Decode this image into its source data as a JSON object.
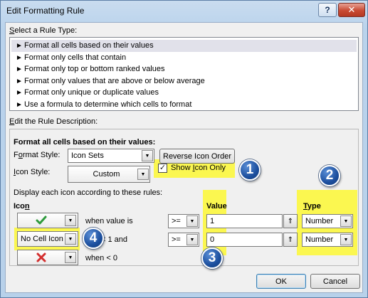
{
  "window": {
    "title": "Edit Formatting Rule",
    "help_glyph": "?",
    "close_glyph": "✕"
  },
  "rule_type": {
    "label_accel": "S",
    "label_rest": "elect a Rule Type:",
    "items": [
      {
        "label": "Format all cells based on their values",
        "selected": true
      },
      {
        "label": "Format only cells that contain",
        "selected": false
      },
      {
        "label": "Format only top or bottom ranked values",
        "selected": false
      },
      {
        "label": "Format only values that are above or below average",
        "selected": false
      },
      {
        "label": "Format only unique or duplicate values",
        "selected": false
      },
      {
        "label": "Use a formula to determine which cells to format",
        "selected": false
      }
    ]
  },
  "description": {
    "label_accel": "E",
    "label_rest": "dit the Rule Description:",
    "heading": "Format all cells based on their values:",
    "format_style_label_pre": "F",
    "format_style_label_accel": "o",
    "format_style_label_post": "rmat Style:",
    "format_style_value": "Icon Sets",
    "reverse_icon_order_label": "Reverse Icon Order",
    "icon_style_label_pre": "",
    "icon_style_label_accel": "I",
    "icon_style_label_post": "con Style:",
    "icon_style_value": "Custom",
    "show_icon_only_pre": "Show ",
    "show_icon_only_accel": "I",
    "show_icon_only_post": "con Only",
    "show_icon_only_checked": true,
    "display_rules_label": "Display each icon according to these rules:",
    "col_icon_pre": "Ico",
    "col_icon_accel": "n",
    "col_value": "Value",
    "col_type_accel": "T",
    "col_type_rest": "ype",
    "rules": [
      {
        "icon": "green-check-icon",
        "icon_text": "",
        "condition": "when value is",
        "operator": ">=",
        "value": "1",
        "type": "Number"
      },
      {
        "icon": "no-cell-icon",
        "icon_text": "No Cell Icon",
        "condition": "< 1 and",
        "operator": ">=",
        "value": "0",
        "type": "Number"
      },
      {
        "icon": "red-x-icon",
        "icon_text": "",
        "condition": "when < 0"
      }
    ]
  },
  "callouts": [
    "1",
    "2",
    "3",
    "4"
  ],
  "buttons": {
    "ok": "OK",
    "cancel": "Cancel"
  },
  "colors": {
    "highlight": "#fbf750",
    "badge": "#1c4f9e",
    "check": "#2e9b3c",
    "x_mark": "#d32f2f"
  }
}
